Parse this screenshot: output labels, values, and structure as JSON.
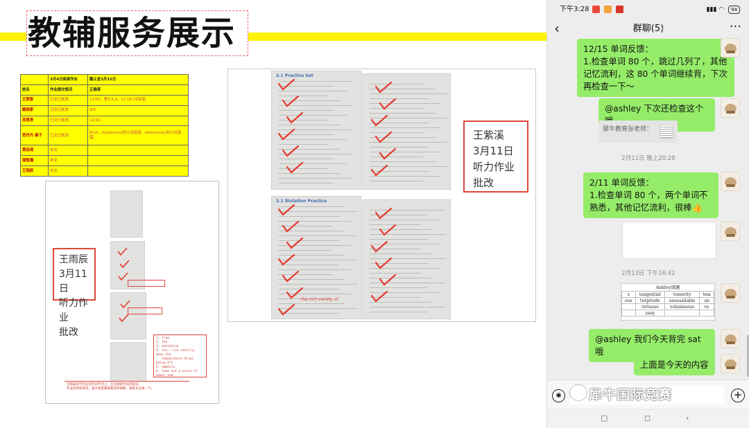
{
  "slide": {
    "title": "教辅服务展示"
  },
  "table": {
    "header": [
      "",
      "3月4日阅读作业",
      "截止至3月15日"
    ],
    "subheader": [
      "姓名",
      "作业提交情况",
      "正确率"
    ],
    "rows": [
      {
        "name": "王思智",
        "status": "已交已批改",
        "remark": "12/20，第3,5,9，12,18,19有错。"
      },
      {
        "name": "鲍锐家",
        "status": "已交已批改",
        "remark": "9/9"
      },
      {
        "name": "苏思贤",
        "status": "已交已批改",
        "remark": "10/10。"
      },
      {
        "name": "范丹丹 裘子",
        "status": "已交已批改",
        "remark": "8/10，mysterious同义词选错，extensively同义词选错。"
      },
      {
        "name": "黄佳琦",
        "status": "未交",
        "remark": ""
      },
      {
        "name": "邹智瀚",
        "status": "未交",
        "remark": ""
      },
      {
        "name": "王雨辰",
        "status": "未交",
        "remark": ""
      }
    ]
  },
  "left_panel": {
    "label": "王雨辰\n3月11日\n听力作业\n批改",
    "note": "1. from\n2. the\n3. attention\n4. ice...ice utterly, when the\n   temperature drops below 0°C\n5. ammonia\n6. take out a piece of paper and\n   a pen. imagine you were in a time\n   machine. The reason why you\n   chose the place and time\n7. a good rehearsal on what...\n   crucial figure to the transition\n   process; close your eyes",
    "footer_note": "王雨辰同学作业在时间节点上，应当规定时间到提交。\n作业的完成情况，很大程度都要靠老师讲解，请家长注意一下。"
  },
  "mid_panel": {
    "label": "王紫溪\n3月11日\n听力作业\n批改",
    "doc_top_left_heading": "2.1 Practice Set",
    "doc_bottom_left_heading": "2.1 Dictation Practice",
    "doc_annotation": "the rich variety of"
  },
  "phone": {
    "status_time": "下午3:28",
    "battery": "94",
    "chat_title": "群聊(5)",
    "messages": {
      "m1": "12/15 单词反馈：\n1.检查单词 80 个，跳过几列了，其他记忆流利，这 80 个单词继续背，下次再检查一下～",
      "m2": "@ashley 下次还检查这个哦",
      "quote": "犀牛教育张老师：",
      "ts1": "2月11日 晚上20:28",
      "m3": "2/11 单词反馈：\n1.检查单词 80 个，两个单词不熟悉，其他记忆流利，很棒👍",
      "ts2": "2月13日 下午16:42",
      "m4": "@ashley 我们今天背完 sat 哦",
      "m5": "上面是今天的内容"
    },
    "word_grid": {
      "caption": "Ashley词测",
      "rows": [
        [
          "s",
          "tangential",
          "temerity",
          "tem"
        ],
        [
          "ous",
          "turpitude",
          "unassailable",
          "un"
        ],
        [
          "",
          "virtuoso",
          "voluminous",
          "vo"
        ],
        [
          "",
          "zany",
          "",
          ""
        ]
      ]
    },
    "nav": [
      "▢",
      "◻",
      "‹"
    ]
  },
  "watermark": "犀牛国际竞赛"
}
